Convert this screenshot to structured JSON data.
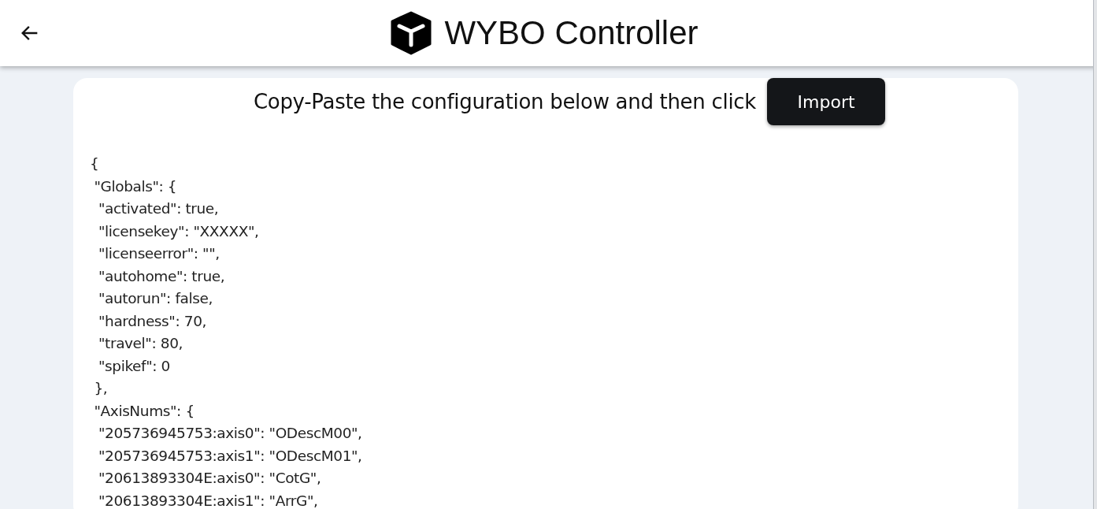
{
  "header": {
    "title": "WYBO Controller"
  },
  "prompt": {
    "text": "Copy-Paste the configuration below and then click",
    "button": "Import"
  },
  "config_lines": [
    "{",
    " \"Globals\": {",
    "  \"activated\": true,",
    "  \"licensekey\": \"XXXXX\",",
    "  \"licenseerror\": \"\",",
    "  \"autohome\": true,",
    "  \"autorun\": false,",
    "  \"hardness\": 70,",
    "  \"travel\": 80,",
    "  \"spikef\": 0",
    " },",
    " \"AxisNums\": {",
    "  \"205736945753:axis0\": \"ODescM00\",",
    "  \"205736945753:axis1\": \"ODescM01\",",
    "  \"20613893304E:axis0\": \"CotG\",",
    "  \"20613893304E:axis1\": \"ArrG\","
  ]
}
